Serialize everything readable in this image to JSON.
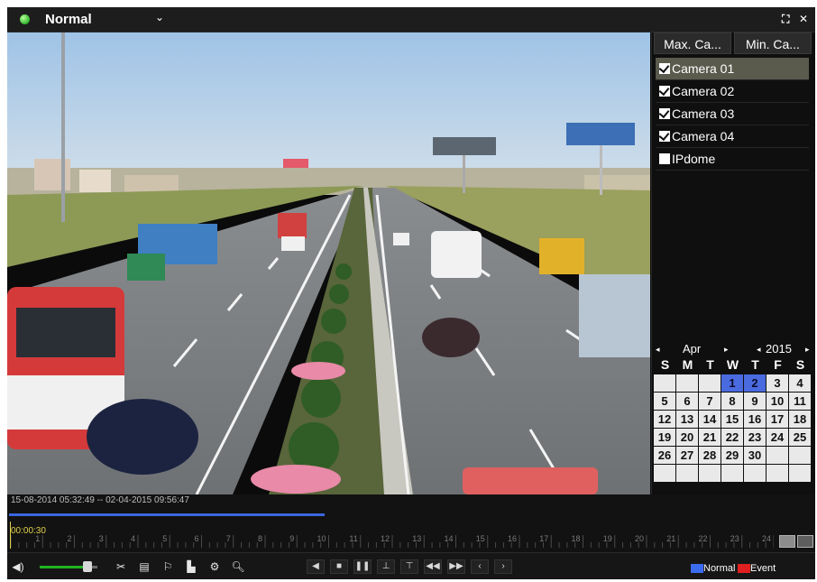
{
  "titlebar": {
    "mode": "Normal",
    "caret": "⌄",
    "fullscreen_icon": "fullscreen-icon",
    "close_icon": "close-icon"
  },
  "panel": {
    "tabs": [
      "Max. Ca...",
      "Min. Ca..."
    ],
    "cameras": [
      {
        "label": "Camera 01",
        "checked": true,
        "selected": true
      },
      {
        "label": "Camera 02",
        "checked": true,
        "selected": false
      },
      {
        "label": "Camera 03",
        "checked": true,
        "selected": false
      },
      {
        "label": "Camera 04",
        "checked": true,
        "selected": false
      },
      {
        "label": "IPdome",
        "checked": false,
        "selected": false
      }
    ]
  },
  "calendar": {
    "month": "Apr",
    "year": "2015",
    "weekdays": [
      "S",
      "M",
      "T",
      "W",
      "T",
      "F",
      "S"
    ],
    "days": [
      "",
      "",
      "",
      "1",
      "2",
      "3",
      "4",
      "5",
      "6",
      "7",
      "8",
      "9",
      "10",
      "11",
      "12",
      "13",
      "14",
      "15",
      "16",
      "17",
      "18",
      "19",
      "20",
      "21",
      "22",
      "23",
      "24",
      "25",
      "26",
      "27",
      "28",
      "29",
      "30",
      "",
      "",
      "",
      "",
      "",
      "",
      "",
      "",
      ""
    ],
    "recorded_days": [
      "1",
      "2"
    ]
  },
  "timeline": {
    "range": "15-08-2014 05:32:49 -- 02-04-2015 09:56:47",
    "current_time": "00:00:30",
    "hour_labels": [
      "1",
      "2",
      "3",
      "4",
      "5",
      "6",
      "7",
      "8",
      "9",
      "10",
      "11",
      "12",
      "13",
      "14",
      "15",
      "16",
      "17",
      "18",
      "19",
      "20",
      "21",
      "22",
      "23",
      "24"
    ]
  },
  "controls": {
    "legend": [
      {
        "label": "Normal",
        "color": "#3b6cf0"
      },
      {
        "label": "Event",
        "color": "#e02020"
      }
    ]
  },
  "colors": {
    "accent_green": "#2fb52b",
    "record_blue": "#4a6be0"
  }
}
